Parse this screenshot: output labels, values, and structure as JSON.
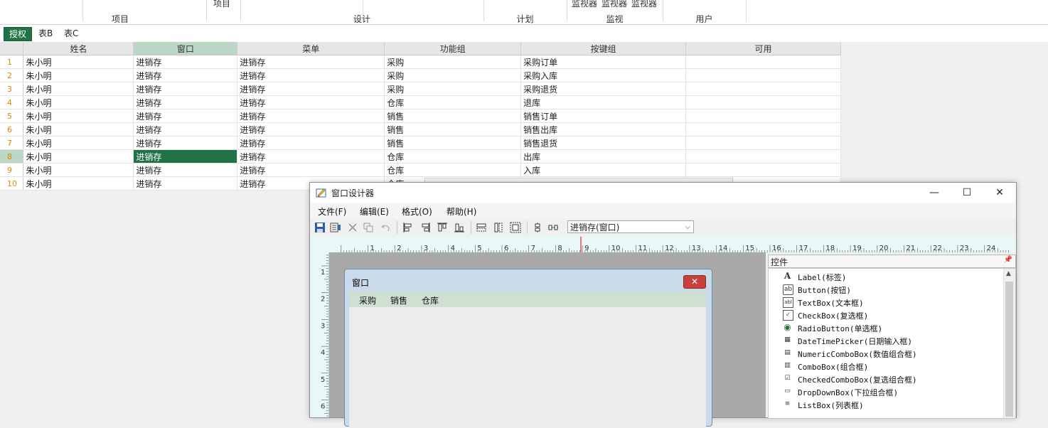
{
  "ribbon": {
    "small_items": [
      "项目",
      "监视器",
      "监视器",
      "监视器"
    ],
    "groups": [
      "项目",
      "设计",
      "计划",
      "监视",
      "用户"
    ]
  },
  "sheet_tabs": [
    "授权",
    "表B",
    "表C"
  ],
  "grid": {
    "columns": [
      "姓名",
      "窗口",
      "菜单",
      "功能组",
      "按键组",
      "可用"
    ],
    "rows": [
      [
        "朱小明",
        "进销存",
        "进销存",
        "采购",
        "采购订单",
        ""
      ],
      [
        "朱小明",
        "进销存",
        "进销存",
        "采购",
        "采购入库",
        ""
      ],
      [
        "朱小明",
        "进销存",
        "进销存",
        "采购",
        "采购退货",
        ""
      ],
      [
        "朱小明",
        "进销存",
        "进销存",
        "仓库",
        "退库",
        ""
      ],
      [
        "朱小明",
        "进销存",
        "进销存",
        "销售",
        "销售订单",
        ""
      ],
      [
        "朱小明",
        "进销存",
        "进销存",
        "销售",
        "销售出库",
        ""
      ],
      [
        "朱小明",
        "进销存",
        "进销存",
        "销售",
        "销售退货",
        ""
      ],
      [
        "朱小明",
        "进销存",
        "进销存",
        "仓库",
        "出库",
        ""
      ],
      [
        "朱小明",
        "进销存",
        "进销存",
        "仓库",
        "入库",
        ""
      ],
      [
        "朱小明",
        "进销存",
        "进销存",
        "仓库",
        "",
        ""
      ]
    ],
    "row_numbers": [
      "1",
      "2",
      "3",
      "4",
      "5",
      "6",
      "7",
      "8",
      "9",
      "10"
    ],
    "selected_row": 8,
    "selected_column": "窗口"
  },
  "designer": {
    "title": "窗口设计器",
    "menu": [
      "文件(F)",
      "编辑(E)",
      "格式(O)",
      "帮助(H)"
    ],
    "combo_value": "进销存(窗口)",
    "ruler_h": [
      "1",
      "2",
      "3",
      "4",
      "5",
      "6",
      "7",
      "8",
      "9",
      "10",
      "11",
      "12",
      "13",
      "14",
      "15",
      "16",
      "17",
      "18",
      "19",
      "20",
      "21",
      "22",
      "23",
      "24"
    ],
    "ruler_v": [
      "1",
      "2",
      "3",
      "4",
      "5",
      "6"
    ],
    "form": {
      "title": "窗口",
      "menu": [
        "采购",
        "销售",
        "仓库"
      ]
    },
    "toolbox": {
      "header": "控件",
      "items": [
        {
          "icon": "label-icon",
          "glyph": "A",
          "label": "Label(标签)"
        },
        {
          "icon": "button-icon",
          "glyph": "ab",
          "label": "Button(按钮)"
        },
        {
          "icon": "textbox-icon",
          "glyph": "abl",
          "label": "TextBox(文本框)"
        },
        {
          "icon": "checkbox-icon",
          "glyph": "✓",
          "label": "CheckBox(复选框)"
        },
        {
          "icon": "radiobutton-icon",
          "glyph": "◉",
          "label": "RadioButton(单选框)"
        },
        {
          "icon": "datetimepicker-icon",
          "glyph": "▦",
          "label": "DateTimePicker(日期输入框)"
        },
        {
          "icon": "numericcombobox-icon",
          "glyph": "▤",
          "label": "NumericComboBox(数值组合框)"
        },
        {
          "icon": "combobox-icon",
          "glyph": "▥",
          "label": "ComboBox(组合框)"
        },
        {
          "icon": "checkedcombobox-icon",
          "glyph": "☑",
          "label": "CheckedComboBox(复选组合框)"
        },
        {
          "icon": "dropdownbox-icon",
          "glyph": "▭",
          "label": "DropDownBox(下拉组合框)"
        },
        {
          "icon": "listbox-icon",
          "glyph": "≡",
          "label": "ListBox(列表框)"
        }
      ]
    }
  },
  "colors": {
    "accent": "#217346",
    "selected_header": "#bcd7c6",
    "row_number": "#d68a00",
    "ruler": "#e8f7f7",
    "form_menu": "#cfe0d2",
    "close_red": "#c8403a"
  }
}
